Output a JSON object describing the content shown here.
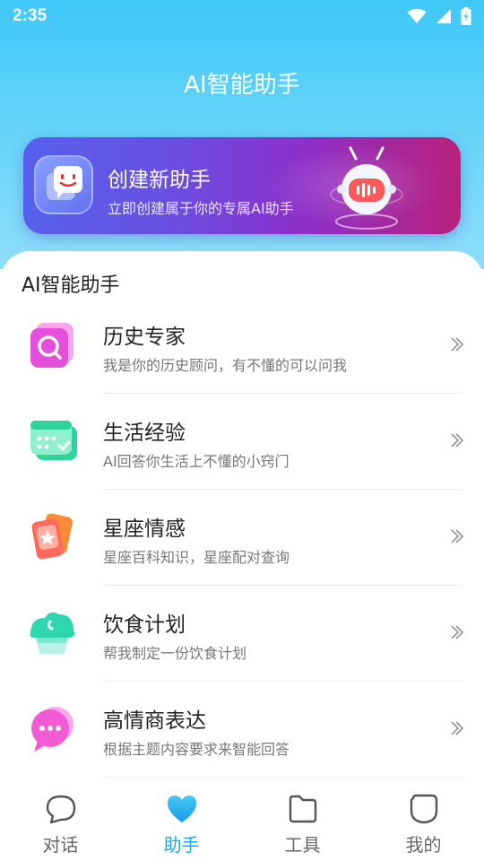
{
  "status_bar": {
    "time": "2:35",
    "icons": [
      "wifi-icon",
      "signal-icon",
      "battery-charging-icon"
    ]
  },
  "header": {
    "title": "AI智能助手"
  },
  "banner": {
    "title": "创建新助手",
    "subtitle": "立即创建属于你的专属AI助手",
    "icon": "chat-bot-face-icon",
    "illustration": "robot-icon"
  },
  "section": {
    "title": "AI智能助手"
  },
  "assistants": [
    {
      "title": "历史专家",
      "desc": "我是你的历史顾问，有不懂的可以问我",
      "icon": "history-search-icon"
    },
    {
      "title": "生活经验",
      "desc": "AI回答你生活上不懂的小窍门",
      "icon": "life-calendar-icon"
    },
    {
      "title": "星座情感",
      "desc": "星座百科知识，星座配对查询",
      "icon": "star-card-icon"
    },
    {
      "title": "饮食计划",
      "desc": "帮我制定一份饮食计划",
      "icon": "food-cake-icon"
    },
    {
      "title": "高情商表达",
      "desc": "根据主题内容要求来智能回答",
      "icon": "speech-bubble-icon"
    }
  ],
  "tabs": [
    {
      "label": "对话",
      "icon": "chat-bubble-icon",
      "active": false
    },
    {
      "label": "助手",
      "icon": "heart-icon",
      "active": true
    },
    {
      "label": "工具",
      "icon": "folder-icon",
      "active": false
    },
    {
      "label": "我的",
      "icon": "profile-icon",
      "active": false
    }
  ],
  "colors": {
    "accent": "#1fa9ec",
    "header_bg": "#3fc8f7",
    "banner_start": "#5561ec",
    "banner_end": "#b8207a"
  }
}
